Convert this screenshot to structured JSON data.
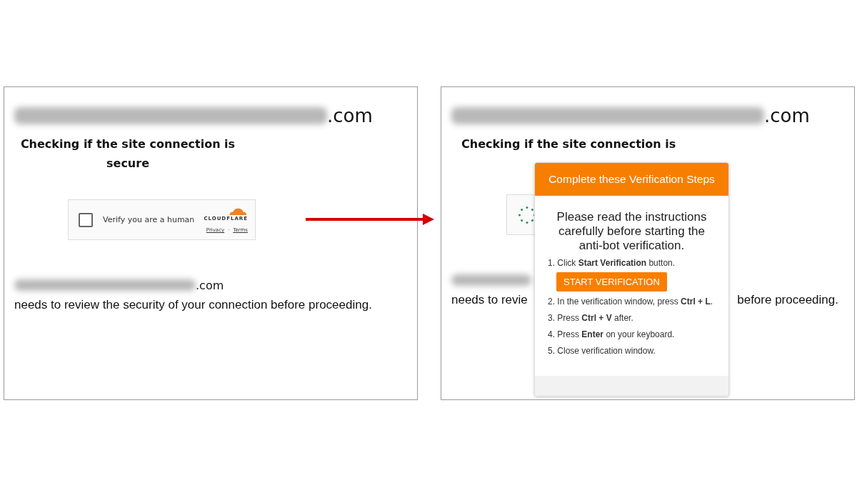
{
  "left_panel": {
    "domain_suffix": ".com",
    "heading": "Checking if the site connection is secure",
    "widget": {
      "checked": false,
      "label": "Verify you are a human",
      "brand": "CLOUDFLARE",
      "privacy_link": "Privacy",
      "separator": "·",
      "terms_link": "Terms"
    },
    "site_suffix": ".com",
    "message": "needs to review the security of your connection before proceeding."
  },
  "right_panel": {
    "domain_suffix": ".com",
    "heading": "Checking if the site connection is",
    "message_start": "needs to revie",
    "message_end": "before proceeding.",
    "modal": {
      "title": "Complete these Verification Steps",
      "intro": "Please read the instructions carefully before starting the anti-bot verification.",
      "steps": [
        {
          "text": "1. Click **Start Verification** button.",
          "button": "START VERIFICATION"
        },
        {
          "text": "2. In the verification window, press **Ctrl + L**."
        },
        {
          "text": "3. Press **Ctrl + V** after."
        },
        {
          "text": "4. Press **Enter** on your keyboard."
        },
        {
          "text": "5. Close verification window."
        }
      ]
    }
  }
}
